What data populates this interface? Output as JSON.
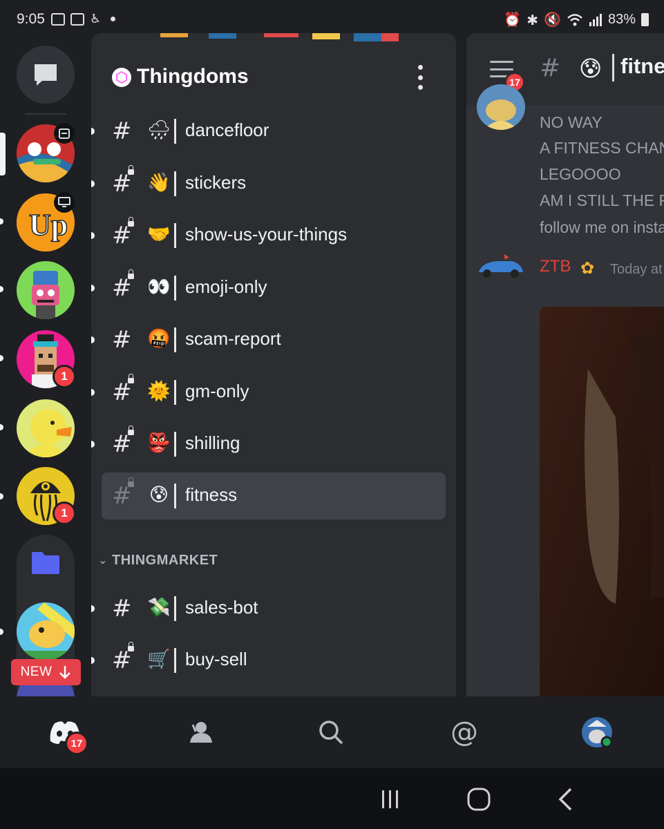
{
  "status_bar": {
    "time": "9:05",
    "battery": "83%",
    "left_icons": [
      "cast-icon",
      "gallery-icon",
      "accessibility-icon",
      "notification-dot"
    ],
    "right_icons": [
      "alarm-icon",
      "bluetooth-icon",
      "mute-icon",
      "wifi-icon",
      "signal-icon",
      "battery-icon"
    ]
  },
  "rail": {
    "servers": [
      {
        "name": "server-gm",
        "badge": "",
        "overlay_icon": "calendar-icon",
        "selected": true
      },
      {
        "name": "server-up",
        "badge": "",
        "overlay_icon": "monitor-icon"
      },
      {
        "name": "server-robot",
        "badge": ""
      },
      {
        "name": "server-pixel-punk",
        "badge": "1"
      },
      {
        "name": "server-duck",
        "badge": ""
      },
      {
        "name": "server-jellyfish",
        "badge": "1"
      }
    ],
    "new_label": "NEW"
  },
  "server": {
    "name": "Thingdoms"
  },
  "channels": [
    {
      "name": "dancefloor",
      "emoji": "🌧",
      "locked": false,
      "unread": true
    },
    {
      "name": "stickers",
      "emoji": "👋",
      "locked": true,
      "unread": true
    },
    {
      "name": "show-us-your-things",
      "emoji": "🤝",
      "locked": true,
      "unread": true
    },
    {
      "name": "emoji-only",
      "emoji": "👀",
      "locked": true,
      "unread": true
    },
    {
      "name": "scam-report",
      "emoji": "🤬",
      "locked": false,
      "unread": true
    },
    {
      "name": "gm-only",
      "emoji": "🌞",
      "locked": true,
      "unread": true
    },
    {
      "name": "shilling",
      "emoji": "👺",
      "locked": true,
      "unread": true
    },
    {
      "name": "fitness",
      "emoji": "😰",
      "locked": true,
      "unread": false,
      "active": true
    }
  ],
  "category": {
    "label": "THINGMARKET"
  },
  "market_channels": [
    {
      "name": "sales-bot",
      "emoji": "💸",
      "locked": false,
      "unread": true
    },
    {
      "name": "buy-sell",
      "emoji": "🛒",
      "locked": true,
      "unread": true
    }
  ],
  "chat": {
    "channel_emoji": "😰",
    "channel_title": "fitness",
    "hamburger_badge": "17",
    "messages": [
      "NO WAY",
      "A FITNESS CHANNEL",
      "LEGOOOO",
      "AM I STILL THE FIRST",
      "follow me on insta"
    ],
    "author": "ZTB",
    "timestamp": "Today at"
  },
  "bottom_nav": {
    "home_badge": "17",
    "tabs": [
      "home",
      "friends",
      "search",
      "mentions",
      "profile"
    ]
  }
}
